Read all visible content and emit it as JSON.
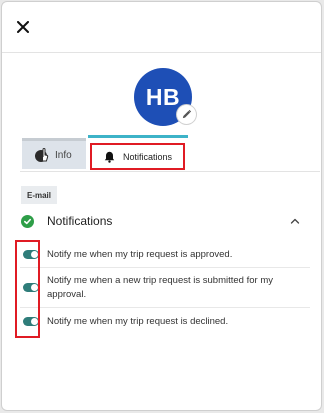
{
  "header": {
    "close_icon": "close-icon"
  },
  "avatar": {
    "initials": "HB",
    "edit_icon": "pencil-icon",
    "color": "#1e4fb6"
  },
  "tabs": [
    {
      "label": "Info",
      "icon": "hand-pointer-icon",
      "active": false
    },
    {
      "label": "Notifications",
      "icon": "bell-icon",
      "active": true
    }
  ],
  "section": {
    "badge": "E-mail",
    "title": "Notifications",
    "status_icon": "check-circle-icon",
    "collapse_icon": "chevron-up-icon",
    "expanded": true
  },
  "notifications": [
    {
      "label": "Notify me when my trip request is approved.",
      "enabled": true
    },
    {
      "label": "Notify me when a new trip request is submitted for my approval.",
      "enabled": true
    },
    {
      "label": "Notify me when my trip request is declined.",
      "enabled": true
    }
  ],
  "colors": {
    "accent": "#3db3c8",
    "toggle_on": "#2f7d7a",
    "highlight": "#e01b24",
    "success": "#2e9e48"
  }
}
